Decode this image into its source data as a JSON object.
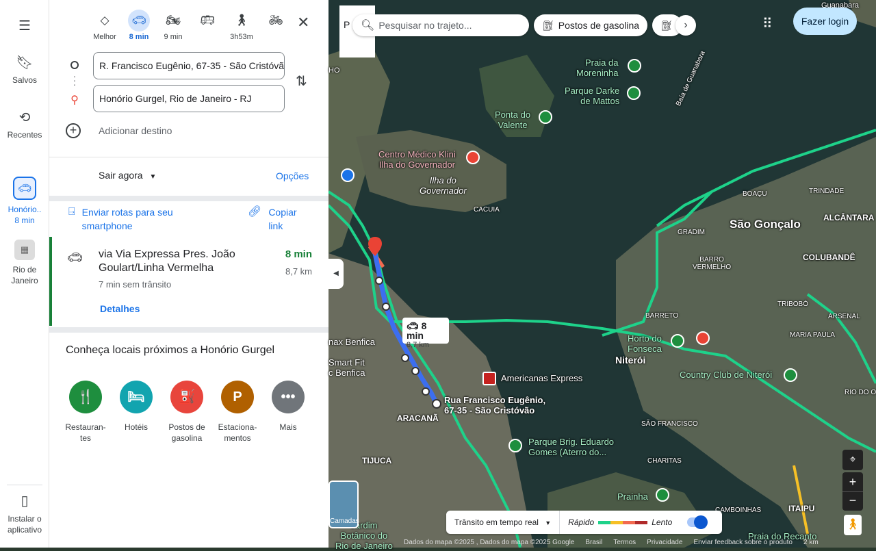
{
  "rail": {
    "menu_icon": "menu-icon",
    "saved": "Salvos",
    "recent": "Recentes",
    "recent_trip_1": "Honório..",
    "recent_trip_1_time": "8 min",
    "recent_trip_2_line1": "Rio de",
    "recent_trip_2_line2": "Janeiro",
    "install_line1": "Instalar o",
    "install_line2": "aplicativo"
  },
  "modes": [
    {
      "label": "Melhor",
      "icon": "diamond-directions-icon"
    },
    {
      "label": "8 min",
      "icon": "car-icon"
    },
    {
      "label": "9 min",
      "icon": "motorcycle-icon"
    },
    {
      "label": "",
      "icon": "bus-icon"
    },
    {
      "label": "3h53m",
      "icon": "walk-icon"
    },
    {
      "label": "",
      "icon": "bicycle-icon"
    }
  ],
  "origin": "R. Francisco Eugênio, 67-35 - São Cristóvão",
  "destination": "Honório Gurgel, Rio de Janeiro - RJ",
  "add_destination": "Adicionar destino",
  "depart": "Sair agora",
  "options": "Opções",
  "send_line1": "Enviar rotas para seu",
  "send_line2": "smartphone",
  "copy_line1": "Copiar",
  "copy_line2": "link",
  "route": {
    "title": "via Via Expressa Pres. João Goulart/Linha Vermelha",
    "time": "8 min",
    "distance": "8,7 km",
    "subtitle": "7 min sem trânsito",
    "details": "Detalhes"
  },
  "nearby_title": "Conheça locais próximos a Honório Gurgel",
  "categories": [
    {
      "l1": "Restauran-",
      "l2": "tes",
      "color": "#1e8e3e",
      "glyph": "🍴"
    },
    {
      "l1": "Hotéis",
      "l2": "",
      "color": "#12a4af",
      "glyph": "🛏"
    },
    {
      "l1": "Postos de",
      "l2": "gasolina",
      "color": "#e8453c",
      "glyph": "⛽"
    },
    {
      "l1": "Estaciona-",
      "l2": "mentos",
      "color": "#b06000",
      "glyph": "P"
    },
    {
      "l1": "Mais",
      "l2": "",
      "color": "#70757a",
      "glyph": "•••"
    }
  ],
  "map": {
    "search_placeholder": "Pesquisar no trajeto...",
    "chip_gas": "Postos de gasolina",
    "login": "Fazer login",
    "route_time": "8 min",
    "route_dist": "8,7 km",
    "labels": {
      "praia_moreninha_1": "Praia da",
      "praia_moreninha_2": "Moreninha",
      "parque_darke_1": "Parque Darke",
      "parque_darke_2": "de Mattos",
      "ponta_1": "Ponta do",
      "ponta_2": "Valente",
      "centro_1": "Centro Médico Klini",
      "centro_2": "Ilha do Governador",
      "ilha_1": "Ilha do",
      "ilha_2": "Governador",
      "cacuia": "CACUIA",
      "sao_goncalo": "São Gonçalo",
      "alcantara": "ALCÂNTARA",
      "colubande": "COLUBANDÊ",
      "gradim": "GRADIM",
      "barro_1": "BARRO",
      "barro_2": "VERMELHO",
      "boacu": "BOAÇU",
      "trindade": "TRINDADE",
      "tribobo": "TRIBOBÓ",
      "arsenal": "ARSENAL",
      "maria_paula": "MARIA PAULA",
      "barreto": "BARRETO",
      "horto_1": "Horto do",
      "horto_2": "Fonseca",
      "niteroi": "Niterói",
      "country": "Country Club de Niterói",
      "sao_francisco": "SÃO FRANCISCO",
      "charitas": "CHARITAS",
      "prainha": "Prainha",
      "cambo": "CAMBOINHAS",
      "itaipu": "ITAIPU",
      "praia_recanto": "Praia do Recanto",
      "rua_1": "Rua Francisco Eugênio,",
      "rua_2": "67-35 - São Cristóvão",
      "americanas": "Americanas Express",
      "parque_brig_1": "Parque Brig. Eduardo",
      "parque_brig_2": "Gomes (Aterro do...",
      "tijuca": "TIJUCA",
      "maracana": "ARACANÃ",
      "smart_1": "Smart Fit",
      "smart_2": "c Benfica",
      "benfica": "nax Benfica",
      "jardim_1": "Jardim",
      "jardim_2": "Botânico do",
      "jardim_3": "Rio de Janeiro",
      "baia": "Baía de Guanabara",
      "guanabara": "Guanabara",
      "rio_do_o": "RIO DO O",
      "ho": "HO"
    },
    "layers": "Camadas",
    "legend_traffic": "Trânsito em tempo real",
    "legend_fast": "Rápido",
    "legend_slow": "Lento",
    "traffic_colors": [
      "#1ed28a",
      "#f6c026",
      "#f26a4f",
      "#b02a2a"
    ],
    "footer": [
      "Dados do mapa ©2025 , Dados do mapa ©2025 Google",
      "Brasil",
      "Termos",
      "Privacidade",
      "Enviar feedback sobre o produto",
      "2 km"
    ]
  }
}
